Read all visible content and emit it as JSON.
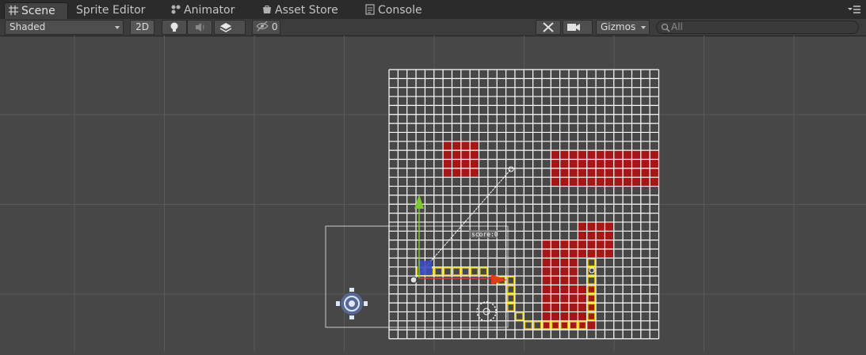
{
  "tabs": [
    {
      "label": "Scene",
      "icon": "grid-icon",
      "active": true
    },
    {
      "label": "Sprite Editor",
      "icon": "",
      "active": false
    },
    {
      "label": "Animator",
      "icon": "animator-icon",
      "active": false
    },
    {
      "label": "Asset Store",
      "icon": "store-icon",
      "active": false
    },
    {
      "label": "Console",
      "icon": "console-icon",
      "active": false
    }
  ],
  "toolbar": {
    "draw_mode": "Shaded",
    "mode_2d": "2D",
    "hidden_count": "0",
    "gizmos_label": "Gizmos",
    "search_placeholder": "All"
  },
  "scene": {
    "label": "score:0"
  },
  "colors": {
    "background": "#474747",
    "tilemap_grid": "#ffffff",
    "wall_tiles": "#a51616",
    "path": "#e0c000",
    "arrow_x": "#e23c1e",
    "arrow_y": "#7ec832"
  }
}
